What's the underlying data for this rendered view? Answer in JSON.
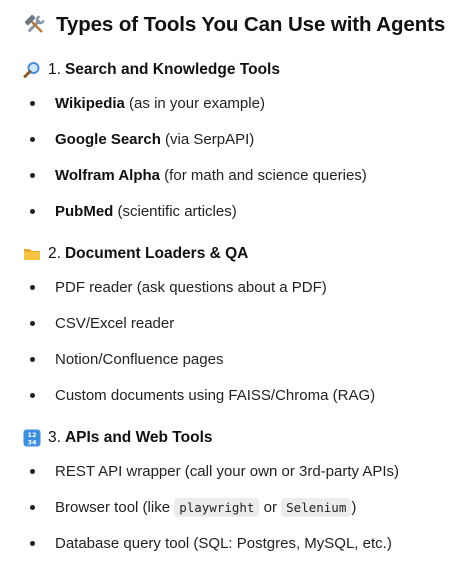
{
  "header": {
    "icon": "hammer-and-wrench-icon",
    "title": "Types of Tools You Can Use with Agents"
  },
  "sections": [
    {
      "icon": "magnifying-glass-icon",
      "number": "1.",
      "title": "Search and Knowledge Tools",
      "items": [
        {
          "bold": "Wikipedia",
          "rest": " (as in your example)"
        },
        {
          "bold": "Google Search",
          "rest": " (via SerpAPI)"
        },
        {
          "bold": "Wolfram Alpha",
          "rest": " (for math and science queries)"
        },
        {
          "bold": "PubMed",
          "rest": " (scientific articles)"
        }
      ]
    },
    {
      "icon": "folder-icon",
      "number": "2.",
      "title": "Document Loaders & QA",
      "items": [
        {
          "text": "PDF reader (ask questions about a PDF)"
        },
        {
          "text": "CSV/Excel reader"
        },
        {
          "text": "Notion/Confluence pages"
        },
        {
          "text": "Custom documents using FAISS/Chroma (RAG)"
        }
      ]
    },
    {
      "icon": "input-numbers-icon",
      "number": "3.",
      "title": "APIs and Web Tools",
      "items": [
        {
          "text": "REST API wrapper (call your own or 3rd-party APIs)"
        },
        {
          "prefix": "Browser tool (like ",
          "code1": "playwright",
          "mid": " or ",
          "code2": "Selenium",
          "suffix": ")"
        },
        {
          "text": "Database query tool (SQL: Postgres, MySQL, etc.)"
        }
      ]
    }
  ]
}
